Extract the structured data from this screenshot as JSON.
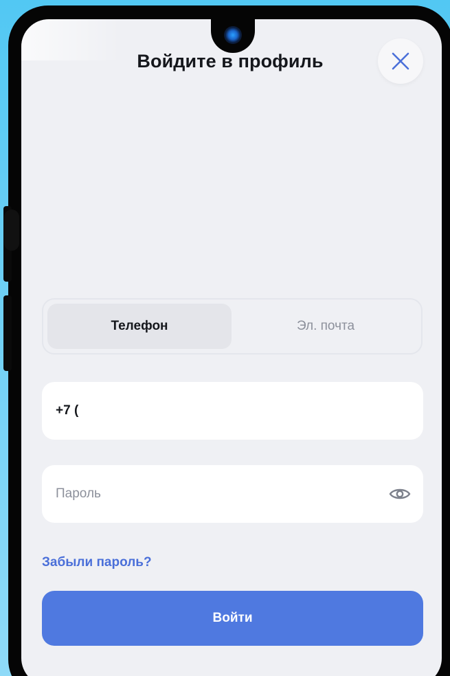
{
  "header": {
    "title": "Войдите в профиль",
    "close_icon": "close-icon"
  },
  "auth_tabs": [
    {
      "label": "Телефон",
      "selected": true
    },
    {
      "label": "Эл. почта",
      "selected": false
    }
  ],
  "phone_input": {
    "value": "+7 ("
  },
  "password_input": {
    "placeholder": "Пароль",
    "toggle_icon": "eye-icon"
  },
  "forgot_link": "Забыли пароль?",
  "login_button": "Войти",
  "colors": {
    "background_outer": "#52c8f3",
    "screen": "#eff0f4",
    "accent": "#4f79e0",
    "link": "#4a6fd9",
    "close_icon": "#4a6fd9"
  }
}
